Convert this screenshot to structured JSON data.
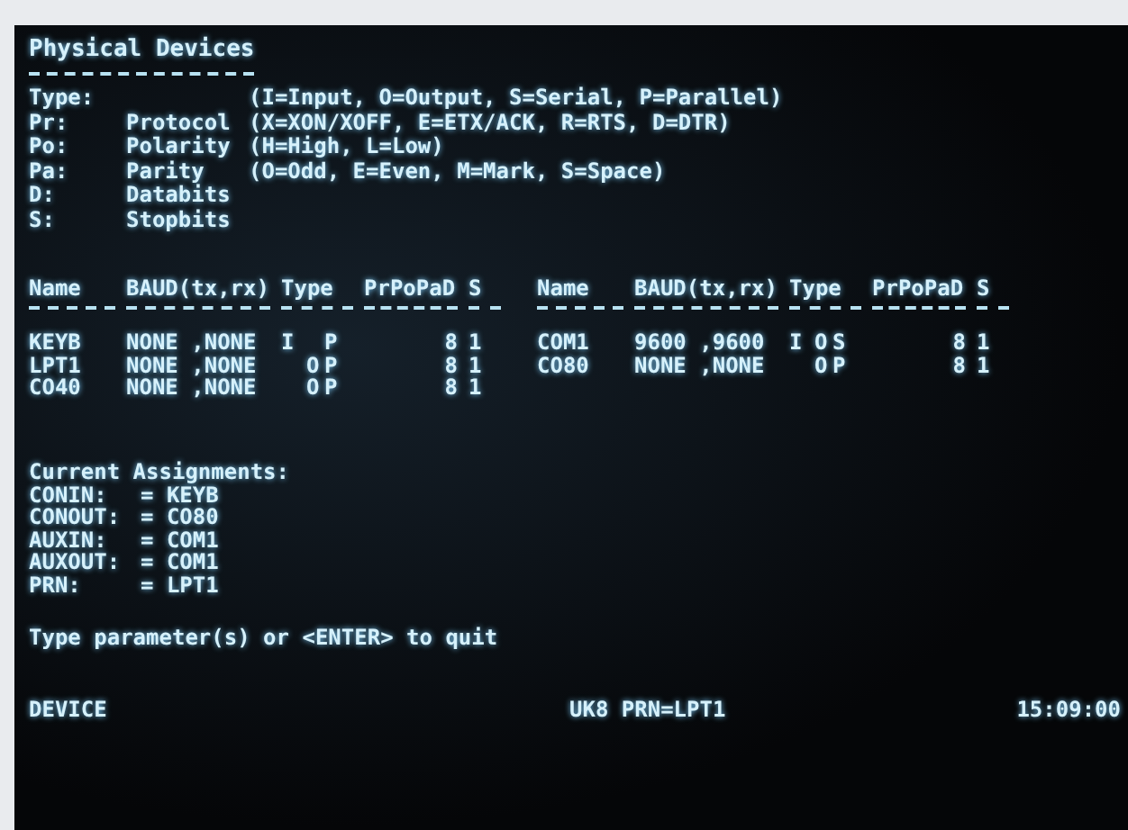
{
  "title": "Physical Devices",
  "legend": [
    {
      "key": "Type:",
      "meaning": "(I=Input, O=Output, S=Serial, P=Parallel)"
    },
    {
      "key": "Pr:",
      "name": "Protocol",
      "meaning": "(X=XON/XOFF, E=ETX/ACK, R=RTS, D=DTR)"
    },
    {
      "key": "Po:",
      "name": "Polarity",
      "meaning": "(H=High, L=Low)"
    },
    {
      "key": "Pa:",
      "name": "Parity",
      "meaning": "(O=Odd, E=Even, M=Mark, S=Space)"
    },
    {
      "key": "D:",
      "name": "Databits"
    },
    {
      "key": "S:",
      "name": "Stopbits"
    }
  ],
  "tables": [
    {
      "columns": [
        "Name",
        "BAUD(tx,rx)",
        "Type",
        "PrPoPaD",
        "S"
      ],
      "rows": [
        {
          "name": "KEYB",
          "baud": "NONE ,NONE",
          "input": "I",
          "interface": "P",
          "databits": "8",
          "stopbits": "1"
        },
        {
          "name": "LPT1",
          "baud": "NONE ,NONE",
          "output": "O",
          "interface": "P",
          "databits": "8",
          "stopbits": "1"
        },
        {
          "name": "CO40",
          "baud": "NONE ,NONE",
          "output": "O",
          "interface": "P",
          "databits": "8",
          "stopbits": "1"
        }
      ]
    },
    {
      "columns": [
        "Name",
        "BAUD(tx,rx)",
        "Type",
        "PrPoPaD",
        "S"
      ],
      "rows": [
        {
          "name": "COM1",
          "baud": "9600 ,9600",
          "input": "I",
          "output": "O",
          "interface": "S",
          "databits": "8",
          "stopbits": "1"
        },
        {
          "name": "CO80",
          "baud": "NONE ,NONE",
          "output": "O",
          "interface": "P",
          "databits": "8",
          "stopbits": "1"
        }
      ]
    }
  ],
  "assignments_title": "Current Assignments:",
  "assignments": [
    {
      "device": "CONIN:",
      "value": "= KEYB"
    },
    {
      "device": "CONOUT:",
      "value": "= CO80"
    },
    {
      "device": "AUXIN:",
      "value": "= COM1"
    },
    {
      "device": "AUXOUT:",
      "value": "= COM1"
    },
    {
      "device": "PRN:",
      "value": "= LPT1"
    }
  ],
  "prompt": "Type parameter(s) or <ENTER> to quit",
  "status_bar": {
    "left": "DEVICE",
    "center": "UK8 PRN=LPT1",
    "right": "15:09:00"
  }
}
